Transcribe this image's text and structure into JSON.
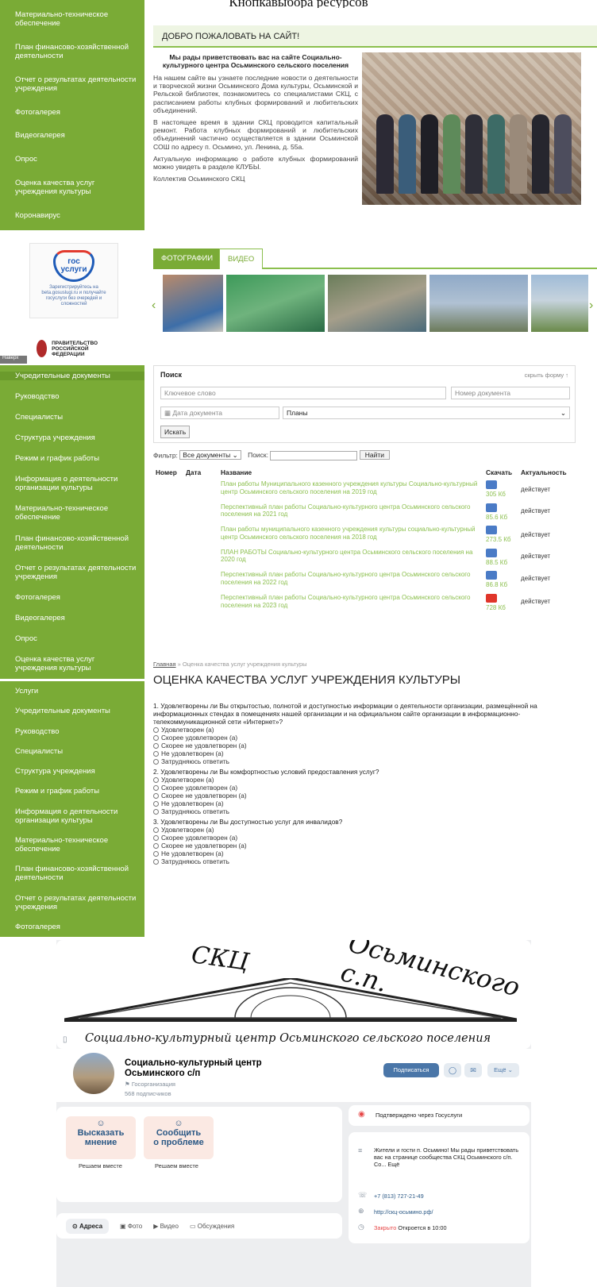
{
  "page": {
    "top_title": "Кнопкавыбора ресурсов"
  },
  "sidebar1": [
    "Материально-техническое обеспечение",
    "План финансово-хозяйственной деятельности",
    "Отчет о результатах деятельности учреждения",
    "Фотогалерея",
    "Видеогалерея",
    "Опрос",
    "Оценка качества услуг учреждения культуры",
    "Коронавирус"
  ],
  "gos": {
    "logo1": "гос",
    "logo2": "услуги",
    "text": "Зарегистрируйтесь на beta.gosuslugi.ru и получайте госуслуги без очередей и сложностей"
  },
  "gov": {
    "text": "ПРАВИТЕЛЬСТВО РОССИЙСКОЙ ФЕДЕРАЦИИ",
    "tab": "Наверх"
  },
  "welcome": {
    "bar": "ДОБРО ПОЖАЛОВАТЬ НА САЙТ!",
    "heading": "Мы рады приветствовать вас на сайте Социально-культурного центра Осьминского сельского поселения",
    "p1": "На нашем сайте вы узнаете последние новости о деятельности и творческой жизни Осьминского Дома культуры, Осьминской и Рельской библиотек, познакомитесь со специалистами СКЦ, с расписанием работы клубных формирований и любительских объединений.",
    "p2": "В настоящее время в здании СКЦ проводится капитальный ремонт. Работа клубных формирований и любительских объединений частично осуществляется в здании Осьминской СОШ по адресу п. Осьмино, ул. Ленина, д. 55а.",
    "p3": "Актуальную информацию о работе клубных формирований можно увидеть в разделе КЛУБЫ.",
    "p4": "Коллектив Осьминского СКЦ"
  },
  "tabs": {
    "photos": "ФОТОГРАФИИ",
    "video": "ВИДЕО"
  },
  "gallery": {
    "prev": "‹",
    "next": "›"
  },
  "sidebar2": [
    "Учредительные документы",
    "Руководство",
    "Специалисты",
    "Структура учреждения",
    "Режим и график работы",
    "Информация о деятельности организации культуры",
    "Материально-техническое обеспечение",
    "План финансово-хозяйственной деятельности",
    "Отчет о результатах деятельности учреждения",
    "Фотогалерея",
    "Видеогалерея",
    "Опрос",
    "Оценка качества услуг учреждения культуры"
  ],
  "search": {
    "title": "Поиск",
    "hide": "скрыть форму ↑",
    "keyword_ph": "Ключевое слово",
    "number_ph": "Номер документа",
    "date_ph": "Дата документа",
    "type_value": "Планы",
    "submit": "Искать",
    "filter_label": "Фильтр:",
    "filter_value": "Все документы",
    "search_label": "Поиск:",
    "find": "Найти"
  },
  "docs": {
    "headers": [
      "Номер",
      "Дата",
      "Название",
      "Скачать",
      "Актуальность"
    ],
    "rows": [
      {
        "name": "План работы Муниципального казенного учреждения культуры Социально-культурный центр Осьминского сельского поселения на 2019 год",
        "size": "305 Кб",
        "status": "действует"
      },
      {
        "name": "Перспективный план работы Социально-культурного центра Осьминского сельского поселения на 2021 год",
        "size": "85.6 Кб",
        "status": "действует"
      },
      {
        "name": "План работы муниципального казенного учреждения культуры социально-культурный центр Осьминского сельского поселения на 2018 год",
        "size": "273.5 Кб",
        "status": "действует"
      },
      {
        "name": "ПЛАН РАБОТЫ Социально-культурного центра Осьминского сельского поселения на 2020 год",
        "size": "88.5 Кб",
        "status": "действует"
      },
      {
        "name": "Перспективный план работы Социально-культурного центра Осьминского сельского поселения на 2022 год",
        "size": "86.8 Кб",
        "status": "действует"
      },
      {
        "name": "Перспективный план работы Социально-культурного центра Осьминского сельского поселения на 2023 год",
        "size": "728 Кб",
        "status": "действует"
      }
    ]
  },
  "sidebar3": [
    "Услуги",
    "Учредительные документы",
    "Руководство",
    "Специалисты",
    "Структура учреждения",
    "Режим и график работы",
    "Информация о деятельности организации культуры",
    "Материально-техническое обеспечение",
    "План финансово-хозяйственной деятельности",
    "Отчет о результатах деятельности учреждения",
    "Фотогалерея"
  ],
  "survey": {
    "crumb_home": "Главная",
    "crumb_rest": " » Оценка качества услуг учреждения культуры",
    "title": "ОЦЕНКА КАЧЕСТВА УСЛУГ УЧРЕЖДЕНИЯ КУЛЬТУРЫ",
    "questions": [
      "1. Удовлетворены ли Вы открытостью, полнотой и доступностью информации о деятельности организации, размещённой на информационных стендах в помещениях нашей организации и на официальном сайте организации в информационно-телекоммуникационной сети «Интернет»?",
      "2. Удовлетворены ли Вы комфортностью условий предоставления услуг?",
      "3. Удовлетворены ли Вы доступностью услуг для инвалидов?"
    ],
    "options": [
      "Удовлетворен (а)",
      "Скорее удовлетворен (а)",
      "Скорее не удовлетворен (а)",
      "Не удовлетворен (а)",
      "Затрудняюсь ответить"
    ]
  },
  "vk": {
    "cover_title1": "СКЦ",
    "cover_title2": "Осьминского с.п.",
    "cover_sub": "Социально-культурный центр Осьминского сельского поселения",
    "name": "Социально-культурный центр Осьминского с/п",
    "type": "Госорганизация",
    "subscribers": "568 подписчиков",
    "subscribe": "Подписаться",
    "more": "Ещё ⌄",
    "act1_l1": "Высказать",
    "act1_l2": "мнение",
    "act1_sub": "Решаем вместе",
    "act2_l1": "Сообщить",
    "act2_l2": "о проблеме",
    "act2_sub": "Решаем вместе",
    "nav": [
      "Адреса",
      "Фото",
      "Видео",
      "Обсуждения"
    ],
    "verified": "Подтверждено через Госуслуги",
    "desc": "Жители и гости п. Осьмино! Мы рады приветствовать вас на странице сообщества СКЦ Осьминского с/п. Со... Ещё",
    "phone": "+7 (813) 727-21-49",
    "site": "http://скц-осьмино.рф/",
    "closed": "Закрыто",
    "opens": "Откроется в 10:00"
  }
}
